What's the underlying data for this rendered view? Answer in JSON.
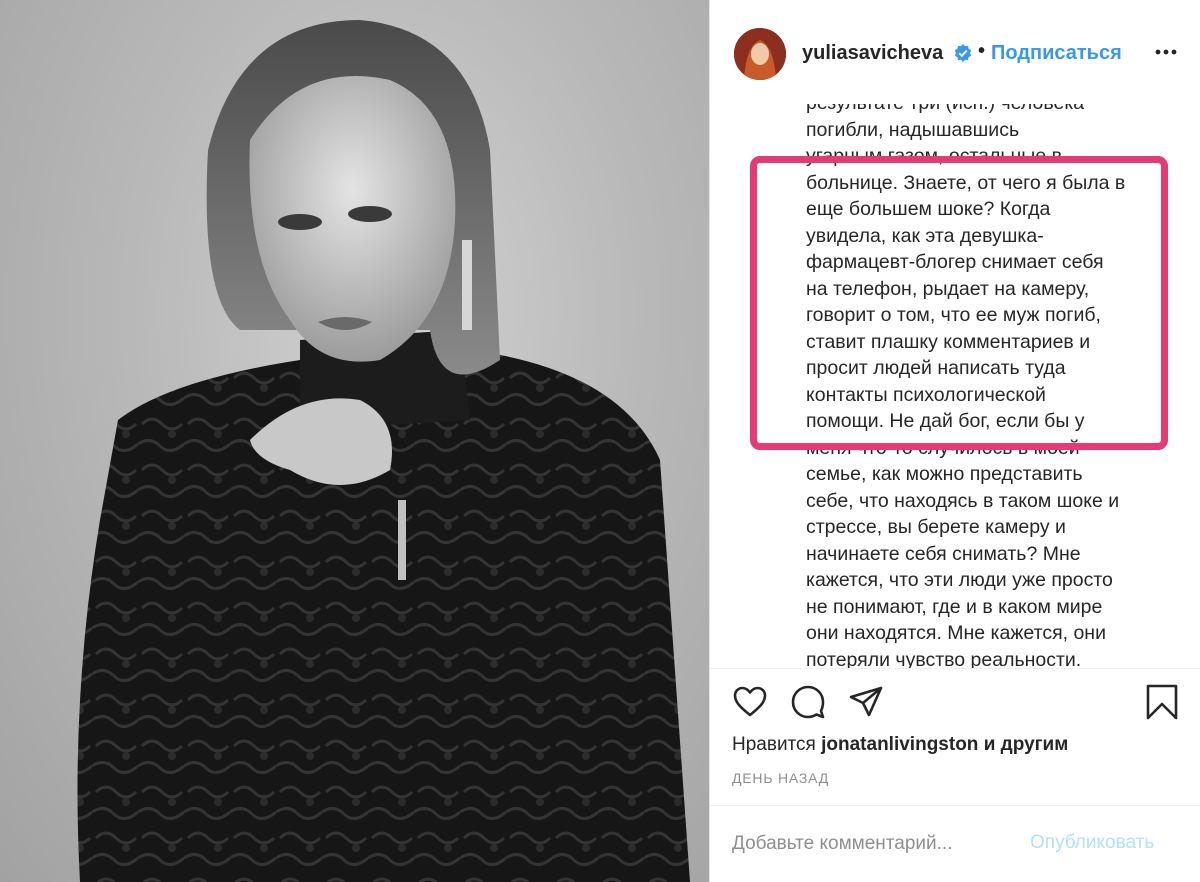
{
  "post": {
    "username": "yuliasavicheva",
    "separator_dot": "•",
    "follow_label": "Подписаться"
  },
  "caption_lines": [
    "результате три (исп.) человека",
    "погибли, надышавшись",
    "угарным газом, остальные в",
    "больнице. Знаете, от чего я была в",
    "еще большем шоке? Когда",
    "увидела, как эта девушка-",
    "фармацевт-блогер снимает себя",
    "на телефон, рыдает на камеру,",
    "говорит о том, что ее муж погиб,",
    "ставит плашку комментариев и",
    "просит людей написать туда",
    "контакты психологической",
    "помощи. Не дай бог, если бы у",
    "меня что-то случилось в моей",
    "семье, как можно представить",
    "себе, что находясь в таком шоке и",
    "стрессе, вы берете камеру и",
    "начинаете себя снимать? Мне",
    "кажется, что эти люди уже просто",
    "не понимают, где и в каком мире",
    "они находятся. Мне кажется, они",
    "потеряли чувство реальности."
  ],
  "likes": {
    "prefix": "Нравится",
    "user": "jonatanlivingston",
    "suffix": "и другим"
  },
  "timestamp": "ДЕНЬ НАЗАД",
  "comment": {
    "placeholder": "Добавьте комментарий...",
    "value": "",
    "publish_label": "Опубликовать"
  },
  "colors": {
    "link_blue": "#3897f0",
    "publish_disabled": "#b2dffc",
    "highlight_pink": "#e53a75",
    "meta_gray": "#8e8e8e"
  },
  "icons": [
    "more-options-icon",
    "verified-badge-icon",
    "heart-icon",
    "comment-icon",
    "share-icon",
    "bookmark-icon"
  ]
}
